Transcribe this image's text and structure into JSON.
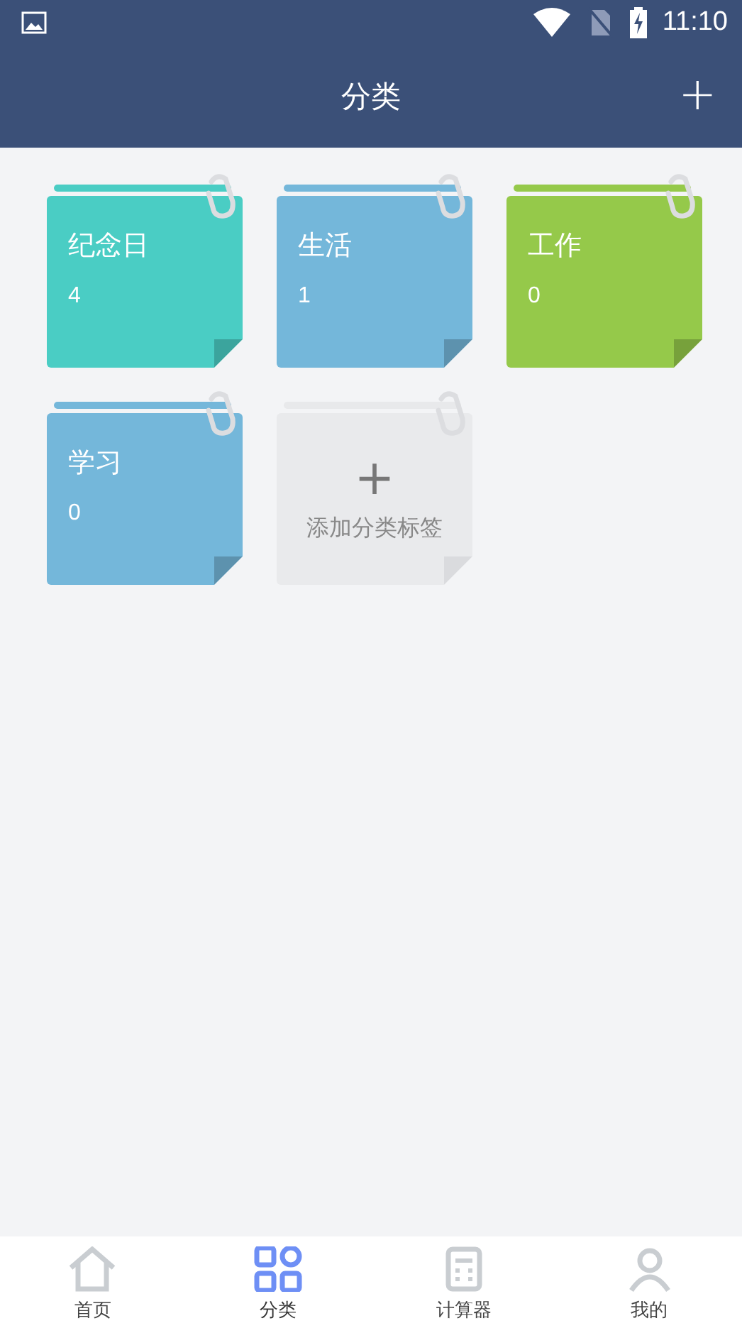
{
  "status_bar": {
    "time": "11:10"
  },
  "header": {
    "title": "分类",
    "add_icon": "+"
  },
  "categories": [
    {
      "kind": "category",
      "name": "纪念日",
      "count": "4",
      "color": "#4acdc4"
    },
    {
      "kind": "category",
      "name": "生活",
      "count": "1",
      "color": "#74b7da"
    },
    {
      "kind": "category",
      "name": "工作",
      "count": "0",
      "color": "#95c94a"
    },
    {
      "kind": "category",
      "name": "学习",
      "count": "0",
      "color": "#74b7da"
    },
    {
      "kind": "add",
      "icon": "+",
      "label": "添加分类标签"
    }
  ],
  "bottom_nav": [
    {
      "kind": "home",
      "label": "首页",
      "selected": false
    },
    {
      "kind": "grid",
      "label": "分类",
      "selected": true
    },
    {
      "kind": "calculator",
      "label": "计算器",
      "selected": false
    },
    {
      "kind": "person",
      "label": "我的",
      "selected": false
    }
  ]
}
